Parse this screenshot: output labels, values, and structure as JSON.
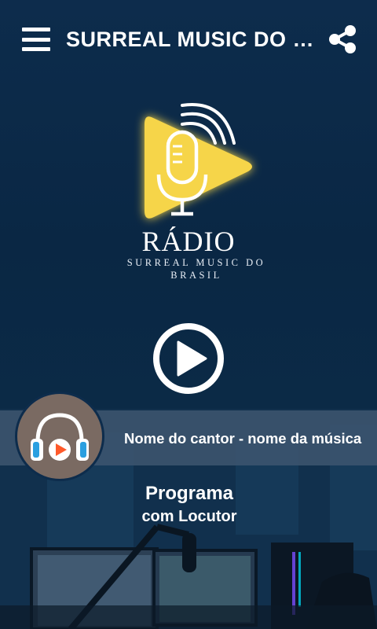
{
  "app_bar": {
    "title": "SURREAL MUSIC DO BRASIL",
    "menu_icon": "hamburger-menu-icon",
    "share_icon": "share-icon"
  },
  "logo": {
    "word": "RÁDIO",
    "subtitle_line1": "SURREAL MUSIC DO",
    "subtitle_line2": "BRASIL",
    "accent_color": "#f6d54a"
  },
  "player": {
    "play_icon": "play-circle-icon",
    "now_playing": "Nome do cantor - nome da música",
    "cover_icon": "headphones-icon"
  },
  "program": {
    "title": "Programa",
    "host": "com Locutor"
  },
  "colors": {
    "background": "#0c2a47",
    "now_playing_bar": "#3c546e",
    "cover_bg": "#7a6a62",
    "text": "#ffffff"
  }
}
